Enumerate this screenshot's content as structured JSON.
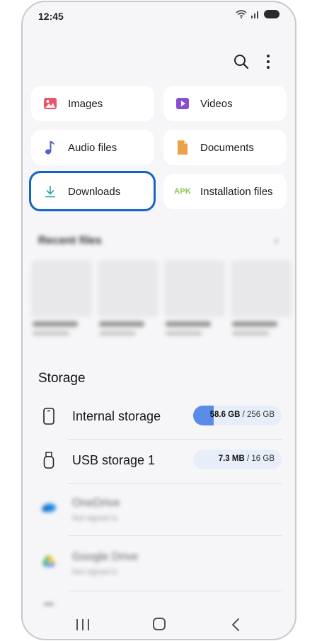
{
  "status_bar": {
    "time": "12:45"
  },
  "categories": [
    {
      "label": "Images",
      "icon": "image-icon",
      "color": "#e8546b"
    },
    {
      "label": "Videos",
      "icon": "video-icon",
      "color": "#8a4fd1"
    },
    {
      "label": "Audio files",
      "icon": "music-note-icon",
      "color": "#5360c8"
    },
    {
      "label": "Documents",
      "icon": "document-icon",
      "color": "#e8a24a"
    },
    {
      "label": "Downloads",
      "icon": "download-icon",
      "color": "#26a69a"
    },
    {
      "label": "Installation files",
      "icon": "apk-icon",
      "icon_text": "APK",
      "color": "#8bc34a"
    }
  ],
  "recent": {
    "title": "Recent files",
    "arrow": "›"
  },
  "storage": {
    "title": "Storage",
    "items": [
      {
        "name": "Internal storage",
        "used": "58.6 GB",
        "total": "/ 256 GB",
        "used_fraction": 0.229
      },
      {
        "name": "USB storage 1",
        "used": "7.3 MB",
        "total": "/ 16 GB",
        "used_fraction": 0.0005
      }
    ],
    "cloud": [
      {
        "name": "OneDrive",
        "sub": "Not signed in"
      },
      {
        "name": "Google Drive",
        "sub": "Not signed in"
      }
    ]
  },
  "accent": "#1565c8"
}
